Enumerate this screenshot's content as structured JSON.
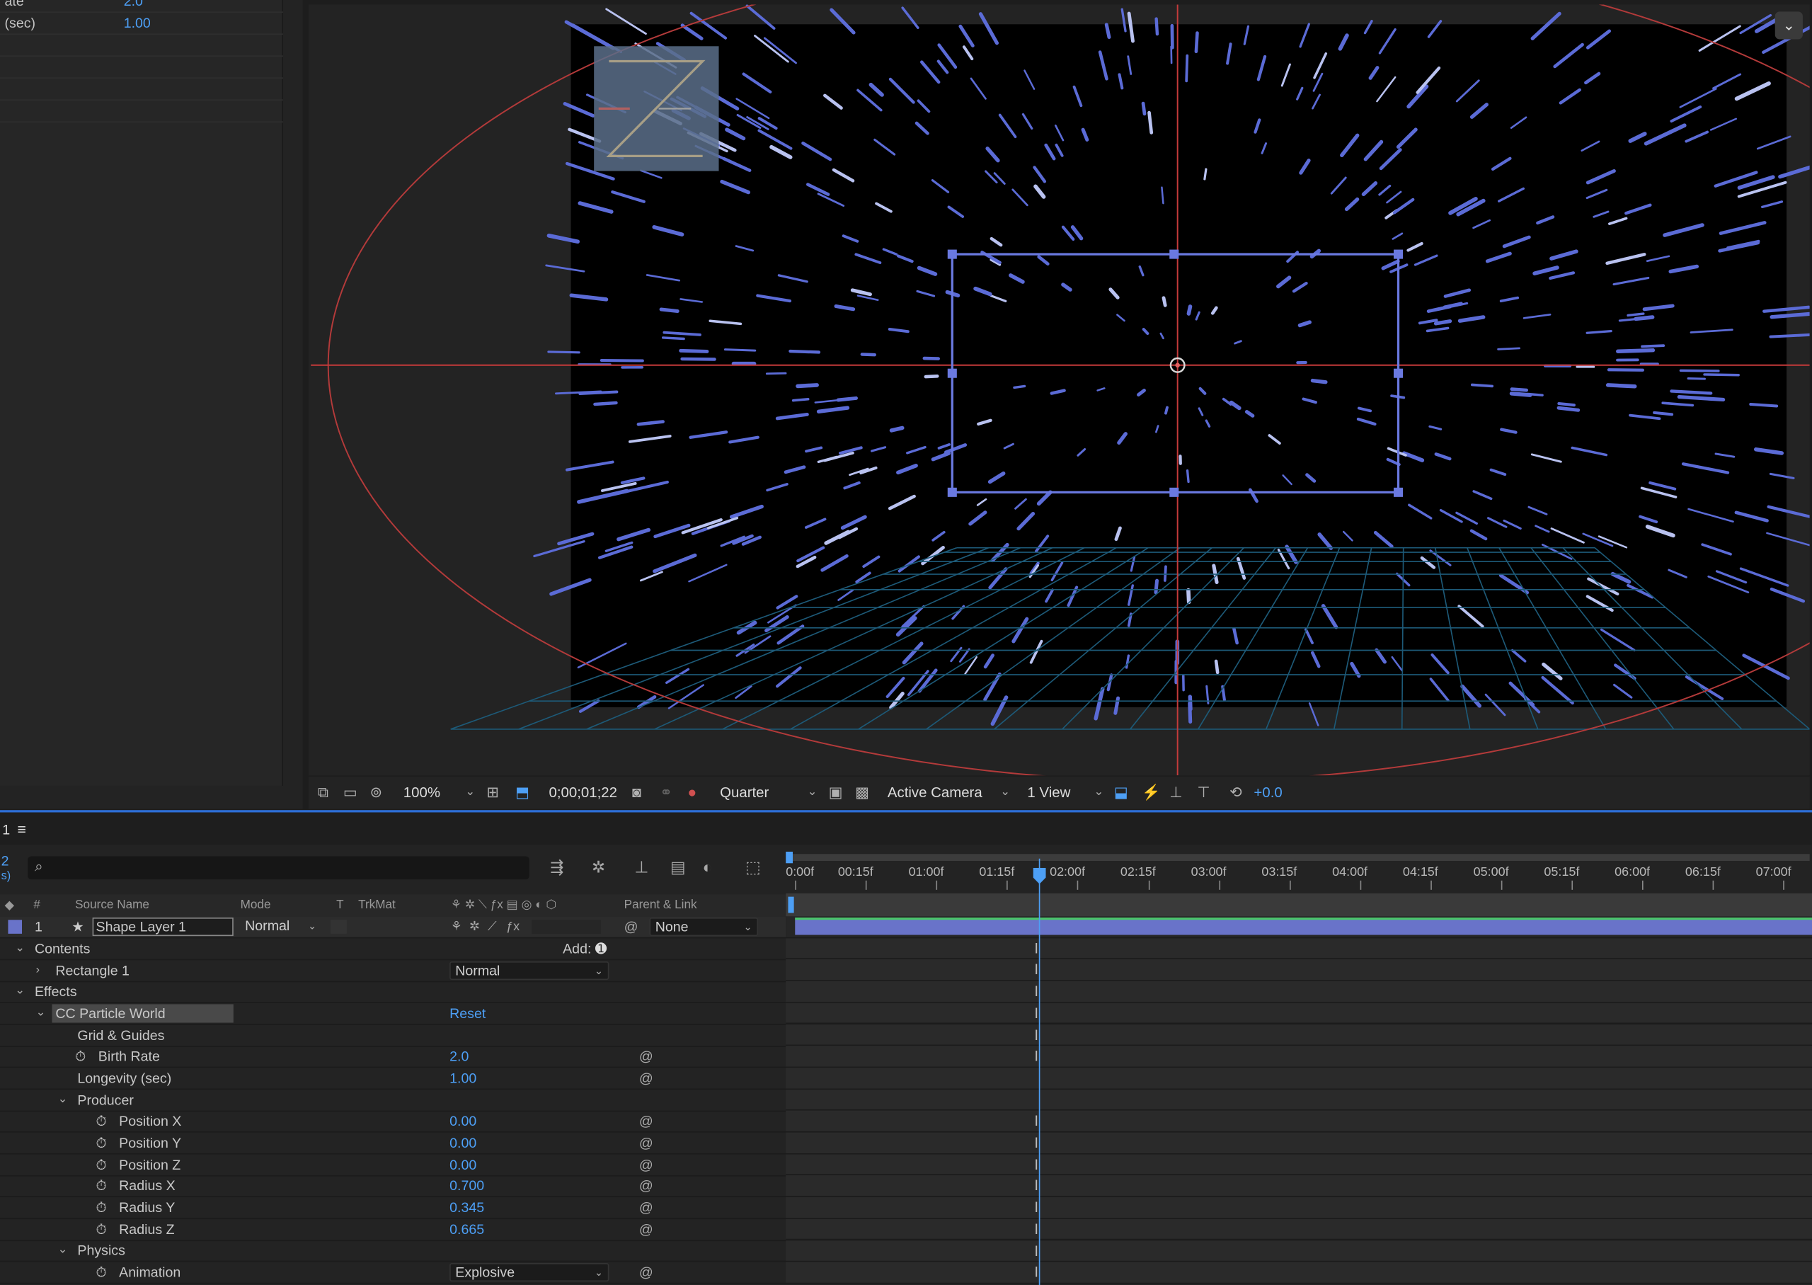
{
  "effect_controls": {
    "rows": [
      {
        "label": "ate",
        "value": "2.0"
      },
      {
        "label": "(sec)",
        "value": "1.00"
      }
    ]
  },
  "viewer": {
    "toolbar": {
      "zoom": "100%",
      "timecode": "0;00;01;22",
      "resolution": "Quarter",
      "camera": "Active Camera",
      "views": "1 View",
      "exposure": "+0.0"
    }
  },
  "timeline": {
    "tab_label": "1",
    "menu_icon": "≡",
    "current_time_fragment": "2",
    "fps_fragment": "s)",
    "columns": {
      "number": "#",
      "source_name": "Source Name",
      "mode": "Mode",
      "t": "T",
      "trkmat": "TrkMat",
      "parent": "Parent & Link"
    },
    "layer": {
      "number": "1",
      "name": "Shape Layer 1",
      "mode": "Normal",
      "parent": "None",
      "color": "#6973c9"
    },
    "properties": {
      "contents": "Contents",
      "add_label": "Add:",
      "rectangle": "Rectangle 1",
      "rectangle_mode": "Normal",
      "effects": "Effects",
      "effect_name": "CC Particle World",
      "reset": "Reset",
      "grid_guides": "Grid & Guides",
      "birth_rate_label": "Birth Rate",
      "birth_rate_value": "2.0",
      "longevity_label": "Longevity (sec)",
      "longevity_value": "1.00",
      "producer": "Producer",
      "pos_x_label": "Position X",
      "pos_x_value": "0.00",
      "pos_y_label": "Position Y",
      "pos_y_value": "0.00",
      "pos_z_label": "Position Z",
      "pos_z_value": "0.00",
      "rad_x_label": "Radius X",
      "rad_x_value": "0.700",
      "rad_y_label": "Radius Y",
      "rad_y_value": "0.345",
      "rad_z_label": "Radius Z",
      "rad_z_value": "0.665",
      "physics": "Physics",
      "animation_label": "Animation",
      "animation_value": "Explosive"
    },
    "ruler": [
      "0:00f",
      "00:15f",
      "01:00f",
      "01:15f",
      "02:00f",
      "02:15f",
      "03:00f",
      "03:15f",
      "04:00f",
      "04:15f",
      "05:00f",
      "05:15f",
      "06:00f",
      "06:15f",
      "07:00f"
    ]
  }
}
